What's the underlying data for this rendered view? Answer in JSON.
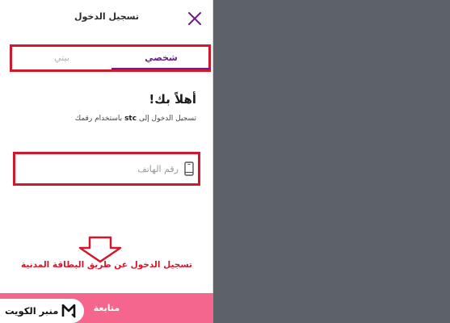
{
  "header": {
    "title": "تسجيل الدخول"
  },
  "tabs": {
    "personal": "شخصي",
    "home": "بيتي"
  },
  "login": {
    "welcome": "أهلاً بك!",
    "subtitle_before": "تسجيل الدخول إلى",
    "subtitle_brand": "stc",
    "subtitle_after": "باستخدام رقمك",
    "phone_placeholder": "رقم الهاتف"
  },
  "civil_id_link": "تسجيل الدخول عن طريق البطاقة المدنية",
  "continue_button": "متابعة",
  "watermark": {
    "text": "منبر الكويت"
  },
  "colors": {
    "brand_purple": "#6c1e8a",
    "highlight_red": "#d2182c",
    "button_pink": "#f5668c",
    "overlay_gray": "#5d6168"
  },
  "icons": {
    "close": "close-icon",
    "phone": "phone-icon",
    "arrow": "arrow-down-icon"
  }
}
